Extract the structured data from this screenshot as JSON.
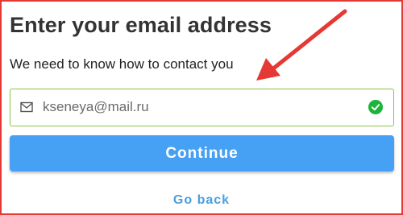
{
  "heading": "Enter your email address",
  "subheading": "We need to know how to contact you",
  "email_field": {
    "value": "kseneya@mail.ru",
    "icon": "mail-icon",
    "status_icon": "check-circle-icon",
    "border_color": "#8bc34a"
  },
  "actions": {
    "continue_label": "Continue",
    "go_back_label": "Go back"
  },
  "colors": {
    "accent": "#46a0f4",
    "link": "#4a9fe0",
    "valid": "#1eb33b",
    "annotation": "#e53935"
  }
}
